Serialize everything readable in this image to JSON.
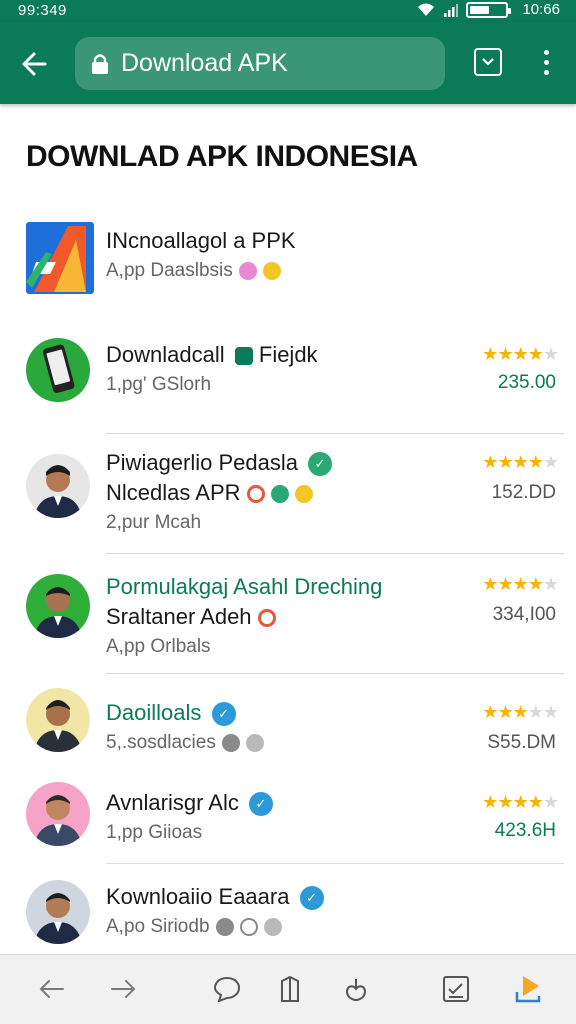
{
  "status_bar": {
    "time_left": "99:349",
    "time_right": "10:66",
    "battery_level": 0.55
  },
  "toolbar": {
    "url_text": "Download APK"
  },
  "page_title": "DOWNLAD APK INDONESIA",
  "items": [
    {
      "title": "INcnoallagol a PPK",
      "sub": "A,pp Daaslbsis",
      "stars": 0,
      "price": ""
    },
    {
      "title": "Downladcall",
      "title_suffix": "Fiejdk",
      "sub": "1,pg' GSlorh",
      "stars": 4,
      "price": "235.00"
    },
    {
      "title": "Piwiagerlio Pedasla",
      "title2": "Nlcedlas APR",
      "sub": "2,pur Mcah",
      "stars": 4,
      "price": "152.DD"
    },
    {
      "title": "Pormulakgaj Asahl Dreching",
      "title2": "Sraltaner Adeh",
      "sub": "A,pp Orlbals",
      "stars": 4,
      "price": "334,I00"
    },
    {
      "title": "Daoilloals",
      "sub": "5,.sosdlacies",
      "stars": 3,
      "price": "S55.DM"
    },
    {
      "title": "Avnlarisgr Alc",
      "sub": "1,pp Giioas",
      "stars": 4,
      "price": "423.6H"
    },
    {
      "title": "Kownloaiio Eaaara",
      "sub": "A,po Siriodb",
      "stars": 0,
      "price": ""
    }
  ],
  "colors": {
    "brand": "#0b7a57",
    "star": "#f5b400",
    "price_green": "#0b7a57"
  }
}
